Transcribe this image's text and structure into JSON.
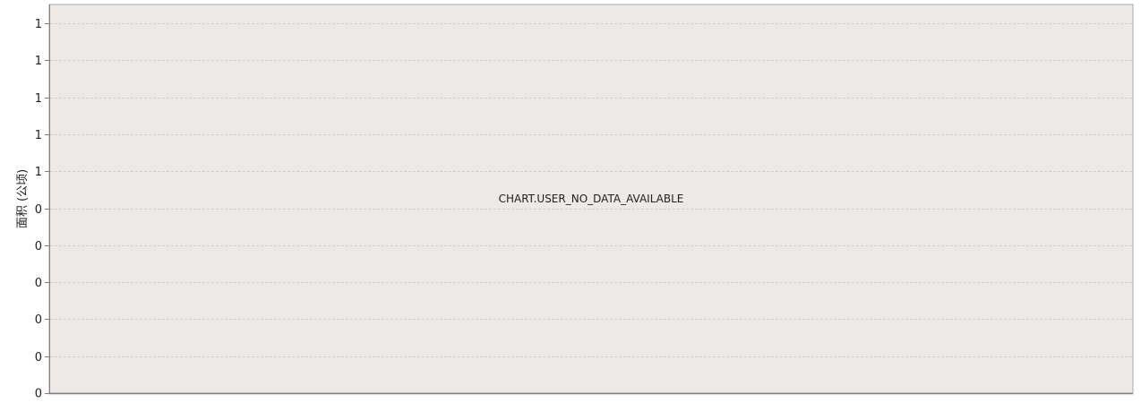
{
  "chart_data": {
    "type": "bar",
    "title": "",
    "xlabel": "",
    "ylabel": "面积 (公顷)",
    "y_tick_labels": [
      "1",
      "1",
      "1",
      "1",
      "1",
      "0",
      "0",
      "0",
      "0",
      "0",
      "0"
    ],
    "series": [],
    "categories": [],
    "grid": true,
    "grid_style": "dashed",
    "no_data_message": "CHART.USER_NO_DATA_AVAILABLE",
    "colors": {
      "plot_background": "#ede9e7",
      "plot_border": "#a9a9a9",
      "grid": "#cfcfcf",
      "axis": "#808080",
      "text": "#222222"
    }
  }
}
